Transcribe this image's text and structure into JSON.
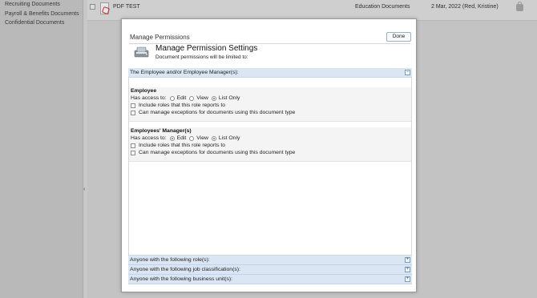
{
  "sidebar": {
    "items": [
      {
        "label": "Recruiting Documents"
      },
      {
        "label": "Payroll & Benefits Documents"
      },
      {
        "label": "Confidential Documents"
      }
    ]
  },
  "document_row": {
    "name": "PDF TEST",
    "category": "Education Documents",
    "date": "2 Mar, 2022 (Red, Kristine)"
  },
  "dialog": {
    "title": "Manage Permissions",
    "done_label": "Done",
    "heading": "Manage Permission Settings",
    "subheading": "Document permissions will be limited to:",
    "main_section": {
      "label": "The Employee and/or Employee Manager(s):",
      "toggle": "−"
    },
    "roles": [
      {
        "title": "Employee",
        "access_label": "Has access to:",
        "options": [
          "Edit",
          "View",
          "List Only"
        ],
        "selected": "List Only",
        "checkboxes": [
          {
            "label": "Include roles that this role reports to",
            "checked": false
          },
          {
            "label": "Can manage exceptions for documents using this document type",
            "checked": false
          }
        ]
      },
      {
        "title": "Employees' Manager(s)",
        "access_label": "Has access to:",
        "options": [
          "Edit",
          "View",
          "List Only"
        ],
        "selected": "List Only",
        "checkboxes": [
          {
            "label": "Include roles that this role reports to",
            "checked": false
          },
          {
            "label": "Can manage exceptions for documents using this document type",
            "checked": false
          }
        ]
      }
    ],
    "bottom_sections": [
      {
        "label": "Anyone with the following role(s):",
        "toggle": "+"
      },
      {
        "label": "Anyone with the following job classification(s):",
        "toggle": "+"
      },
      {
        "label": "Anyone with the following business unit(s):",
        "toggle": "+"
      }
    ]
  }
}
